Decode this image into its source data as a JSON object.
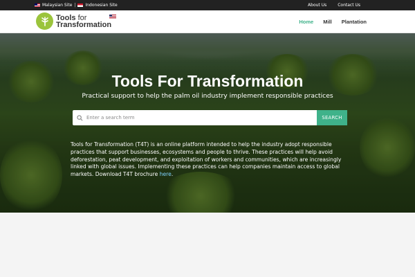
{
  "topbar": {
    "malaysian_site": "Malaysian Site",
    "separator": "|",
    "indonesian_site": "Indonesian Site",
    "about": "About Us",
    "contact": "Contact Us"
  },
  "header": {
    "logo_line1_bold": "Tools",
    "logo_line1_light": "for",
    "logo_line2": "Transformation",
    "nav": [
      "Home",
      "Mill",
      "Plantation"
    ],
    "active_nav": "Home"
  },
  "hero": {
    "title": "Tools For Transformation",
    "subtitle": "Practical support to help the palm oil industry implement responsible practices",
    "search": {
      "placeholder": "Enter a search term",
      "button": "SEARCH"
    },
    "description": "Tools for Transformation (T4T) is an online platform intended to help the industry adopt responsible practices that support businesses, ecosystems and people to thrive. These practices will help avoid deforestation, peat development, and exploitation of workers and communities, which are increasingly linked with global issues. Implementing these practices can help companies maintain access to global markets. Download T4T brochure",
    "link_text": "here",
    "link_suffix": "."
  },
  "colors": {
    "accent": "#3fb28a",
    "logo_green": "#9bc43c",
    "topbar": "#222222"
  },
  "icons": [
    "malaysia-flag-icon",
    "indonesia-flag-icon",
    "logo-mark-icon",
    "us-flag-icon",
    "search-icon"
  ]
}
